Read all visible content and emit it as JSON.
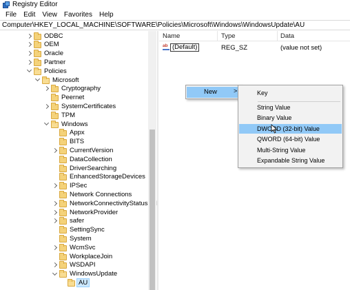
{
  "window": {
    "title": "Registry Editor"
  },
  "menu": [
    "File",
    "Edit",
    "View",
    "Favorites",
    "Help"
  ],
  "address": "Computer\\HKEY_LOCAL_MACHINE\\SOFTWARE\\Policies\\Microsoft\\Windows\\WindowsUpdate\\AU",
  "tree": [
    {
      "label": "ODBC",
      "level": 0,
      "expander": "right",
      "open": false
    },
    {
      "label": "OEM",
      "level": 0,
      "expander": "right",
      "open": false
    },
    {
      "label": "Oracle",
      "level": 0,
      "expander": "right",
      "open": false
    },
    {
      "label": "Partner",
      "level": 0,
      "expander": "right",
      "open": false
    },
    {
      "label": "Policies",
      "level": 0,
      "expander": "down",
      "open": true
    },
    {
      "label": "Microsoft",
      "level": 1,
      "expander": "down",
      "open": true
    },
    {
      "label": "Cryptography",
      "level": 2,
      "expander": "right",
      "open": false
    },
    {
      "label": "Peernet",
      "level": 2,
      "expander": "none",
      "open": false
    },
    {
      "label": "SystemCertificates",
      "level": 2,
      "expander": "right",
      "open": false
    },
    {
      "label": "TPM",
      "level": 2,
      "expander": "none",
      "open": false
    },
    {
      "label": "Windows",
      "level": 2,
      "expander": "down",
      "open": true
    },
    {
      "label": "Appx",
      "level": 3,
      "expander": "none",
      "open": false
    },
    {
      "label": "BITS",
      "level": 3,
      "expander": "none",
      "open": false
    },
    {
      "label": "CurrentVersion",
      "level": 3,
      "expander": "right",
      "open": false
    },
    {
      "label": "DataCollection",
      "level": 3,
      "expander": "none",
      "open": false
    },
    {
      "label": "DriverSearching",
      "level": 3,
      "expander": "none",
      "open": false
    },
    {
      "label": "EnhancedStorageDevices",
      "level": 3,
      "expander": "none",
      "open": false
    },
    {
      "label": "IPSec",
      "level": 3,
      "expander": "right",
      "open": false
    },
    {
      "label": "Network Connections",
      "level": 3,
      "expander": "none",
      "open": false
    },
    {
      "label": "NetworkConnectivityStatusIndi",
      "level": 3,
      "expander": "right",
      "open": false
    },
    {
      "label": "NetworkProvider",
      "level": 3,
      "expander": "right",
      "open": false
    },
    {
      "label": "safer",
      "level": 3,
      "expander": "right",
      "open": false
    },
    {
      "label": "SettingSync",
      "level": 3,
      "expander": "none",
      "open": false
    },
    {
      "label": "System",
      "level": 3,
      "expander": "none",
      "open": false
    },
    {
      "label": "WcmSvc",
      "level": 3,
      "expander": "right",
      "open": false
    },
    {
      "label": "WorkplaceJoin",
      "level": 3,
      "expander": "none",
      "open": false
    },
    {
      "label": "WSDAPI",
      "level": 3,
      "expander": "right",
      "open": false
    },
    {
      "label": "WindowsUpdate",
      "level": 3,
      "expander": "down",
      "open": true
    },
    {
      "label": "AU",
      "level": 4,
      "expander": "none",
      "open": true,
      "selected": true
    }
  ],
  "list": {
    "columns": [
      "Name",
      "Type",
      "Data"
    ],
    "rows": [
      {
        "name": "(Default)",
        "type": "REG_SZ",
        "data": "(value not set)"
      }
    ]
  },
  "context_menu": {
    "new_label": "New",
    "arrow": ">",
    "submenu": [
      {
        "label": "Key",
        "highlight": false
      },
      {
        "label": "String Value",
        "highlight": false
      },
      {
        "label": "Binary Value",
        "highlight": false
      },
      {
        "label": "DWORD (32-bit) Value",
        "highlight": true
      },
      {
        "label": "QWORD (64-bit) Value",
        "highlight": false
      },
      {
        "label": "Multi-String Value",
        "highlight": false
      },
      {
        "label": "Expandable String Value",
        "highlight": false
      }
    ]
  }
}
